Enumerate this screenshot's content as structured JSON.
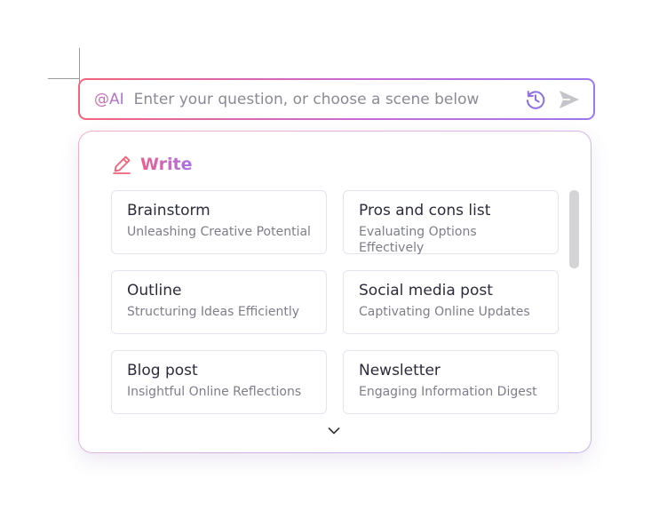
{
  "input": {
    "ai_tag": "@AI",
    "placeholder": "Enter your question, or choose a scene below",
    "value": ""
  },
  "panel": {
    "section_title": "Write",
    "cards": [
      {
        "title": "Brainstorm",
        "subtitle": "Unleashing Creative Potential"
      },
      {
        "title": "Pros and cons list",
        "subtitle": "Evaluating Options Effectively"
      },
      {
        "title": "Outline",
        "subtitle": "Structuring Ideas Efficiently"
      },
      {
        "title": "Social media post",
        "subtitle": "Captivating Online Updates"
      },
      {
        "title": "Blog post",
        "subtitle": "Insightful Online Reflections"
      },
      {
        "title": "Newsletter",
        "subtitle": "Engaging Information Digest"
      }
    ]
  },
  "icons": {
    "history": "history-icon",
    "send": "send-icon",
    "write": "pencil-icon",
    "expand": "chevron-down-icon"
  },
  "colors": {
    "gradient_start": "#f2647a",
    "gradient_mid": "#c86bd6",
    "gradient_end": "#9b78ee",
    "history_icon": "#8f72e0",
    "send_icon": "#c4c4ca"
  }
}
